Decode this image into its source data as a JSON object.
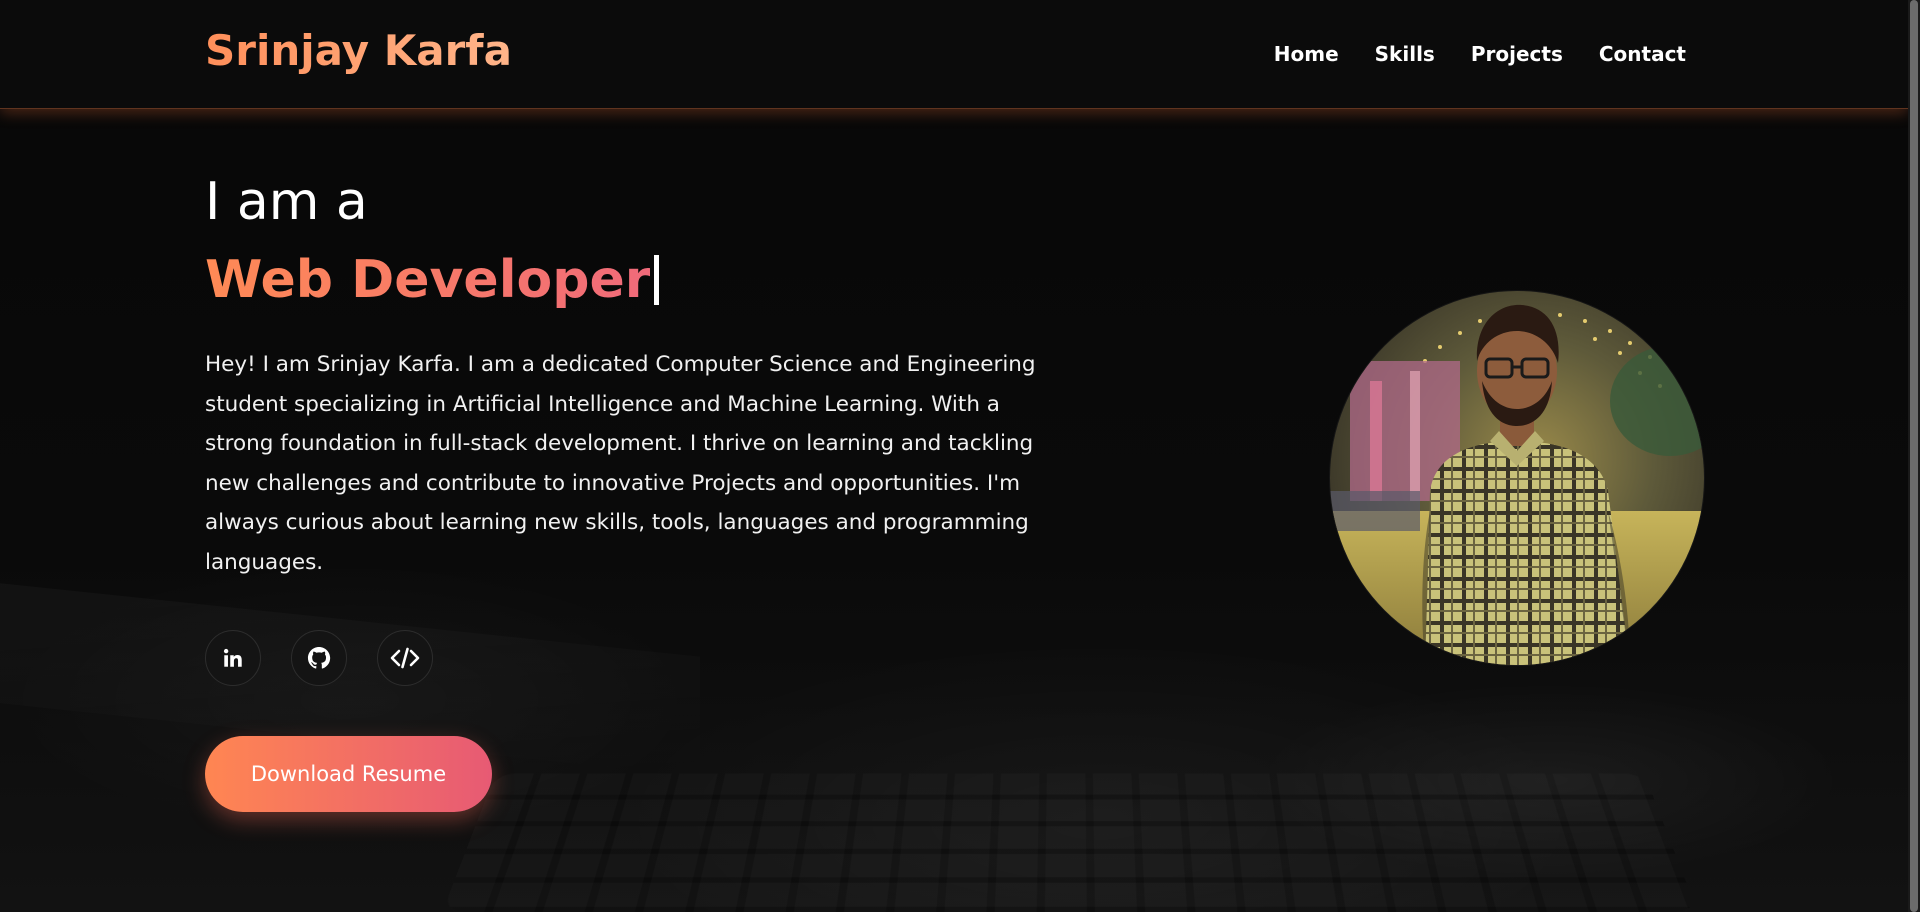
{
  "header": {
    "brand": "Srinjay Karfa",
    "nav": [
      {
        "label": "Home"
      },
      {
        "label": "Skills"
      },
      {
        "label": "Projects"
      },
      {
        "label": "Contact"
      }
    ]
  },
  "hero": {
    "intro": "I am a",
    "role": "Web Developer",
    "bio": "Hey! I am Srinjay Karfa. I am a dedicated Computer Science and Engineering student specializing in Artificial Intelligence and Machine Learning. With a strong foundation in full-stack development. I thrive on learning and tackling new challenges and contribute to innovative Projects and opportunities. I'm always curious about learning new skills, tools, languages and programming languages.",
    "socials": [
      {
        "icon": "linkedin-icon"
      },
      {
        "icon": "github-icon"
      },
      {
        "icon": "code-icon"
      }
    ],
    "resume_button": "Download Resume"
  },
  "colors": {
    "accent_start": "#ff8652",
    "accent_end": "#e75a74",
    "background": "#050505"
  }
}
